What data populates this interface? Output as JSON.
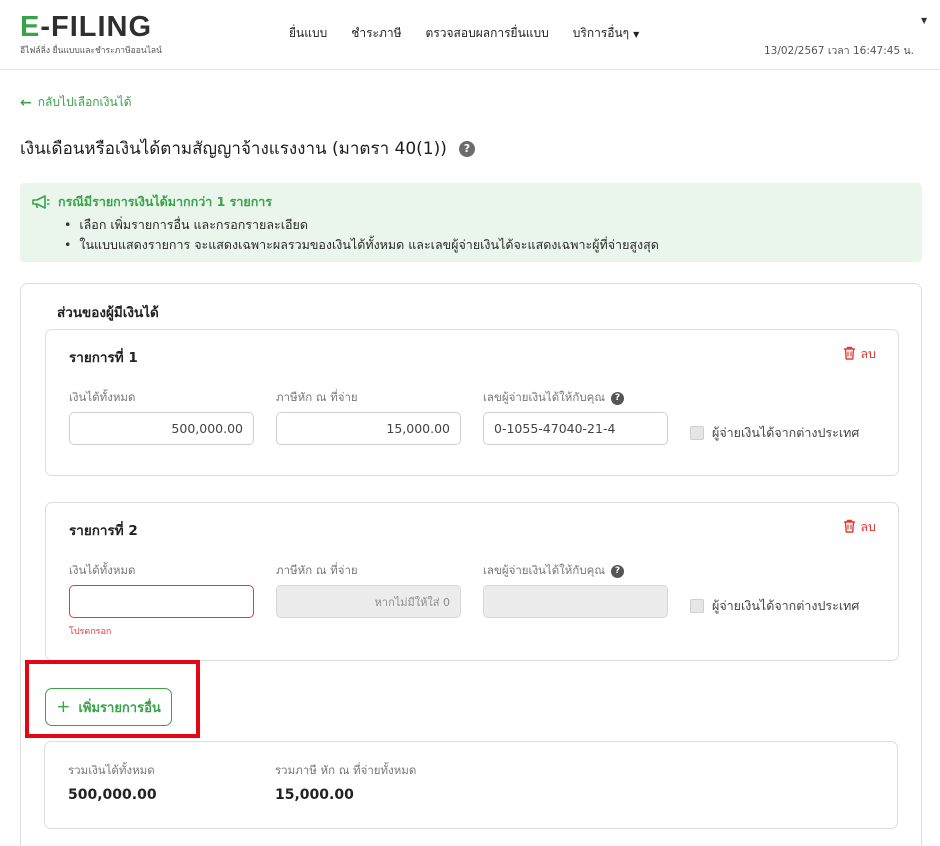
{
  "header": {
    "logo_text": "E-FILING",
    "logo_tagline": "อีไฟล์ลิ่ง ยื่นแบบและชำระภาษีออนไลน์",
    "nav": [
      "ยื่นแบบ",
      "ชำระภาษี",
      "ตรวจสอบผลการยื่นแบบ",
      "บริการอื่นๆ"
    ],
    "datetime": "13/02/2567 เวลา 16:47:45 น."
  },
  "back_link": "กลับไปเลือกเงินได้",
  "page_title": "เงินเดือนหรือเงินได้ตามสัญญาจ้างแรงงาน (มาตรา 40(1))",
  "info": {
    "heading": "กรณีมีรายการเงินได้มากกว่า 1 รายการ",
    "bullets": [
      "เลือก เพิ่มรายการอื่น และกรอกรายละเอียด",
      "ในแบบแสดงรายการ จะแสดงเฉพาะผลรวมของเงินได้ทั้งหมด และเลขผู้จ่ายเงินได้จะแสดงเฉพาะผู้ที่จ่ายสูงสุด"
    ]
  },
  "section_title": "ส่วนของผู้มีเงินได้",
  "labels": {
    "income": "เงินได้ทั้งหมด",
    "tax_withheld": "ภาษีหัก ณ ที่จ่าย",
    "payer_id": "เลขผู้จ่ายเงินได้ให้กับคุณ",
    "foreign_payer": "ผู้จ่ายเงินได้จากต่างประเทศ",
    "delete": "ลบ"
  },
  "items": [
    {
      "title": "รายการที่ 1",
      "income": "500,000.00",
      "tax_withheld": "15,000.00",
      "payer_id": "0-1055-47040-21-4",
      "foreign_checked": false
    },
    {
      "title": "รายการที่ 2",
      "income": "",
      "tax_placeholder": "หากไม่มีให้ใส่ 0",
      "payer_id": "",
      "error": "โปรดกรอก",
      "foreign_checked": false
    }
  ],
  "add_button": "เพิ่มรายการอื่น",
  "totals": {
    "income_label": "รวมเงินได้ทั้งหมด",
    "income_value": "500,000.00",
    "tax_label": "รวมภาษี หัก ณ ที่จ่ายทั้งหมด",
    "tax_value": "15,000.00"
  },
  "colors": {
    "brand_green": "#3aa34a",
    "error_red": "#e53935",
    "highlight_red": "#e30613",
    "info_bg": "#eaf5ec"
  }
}
